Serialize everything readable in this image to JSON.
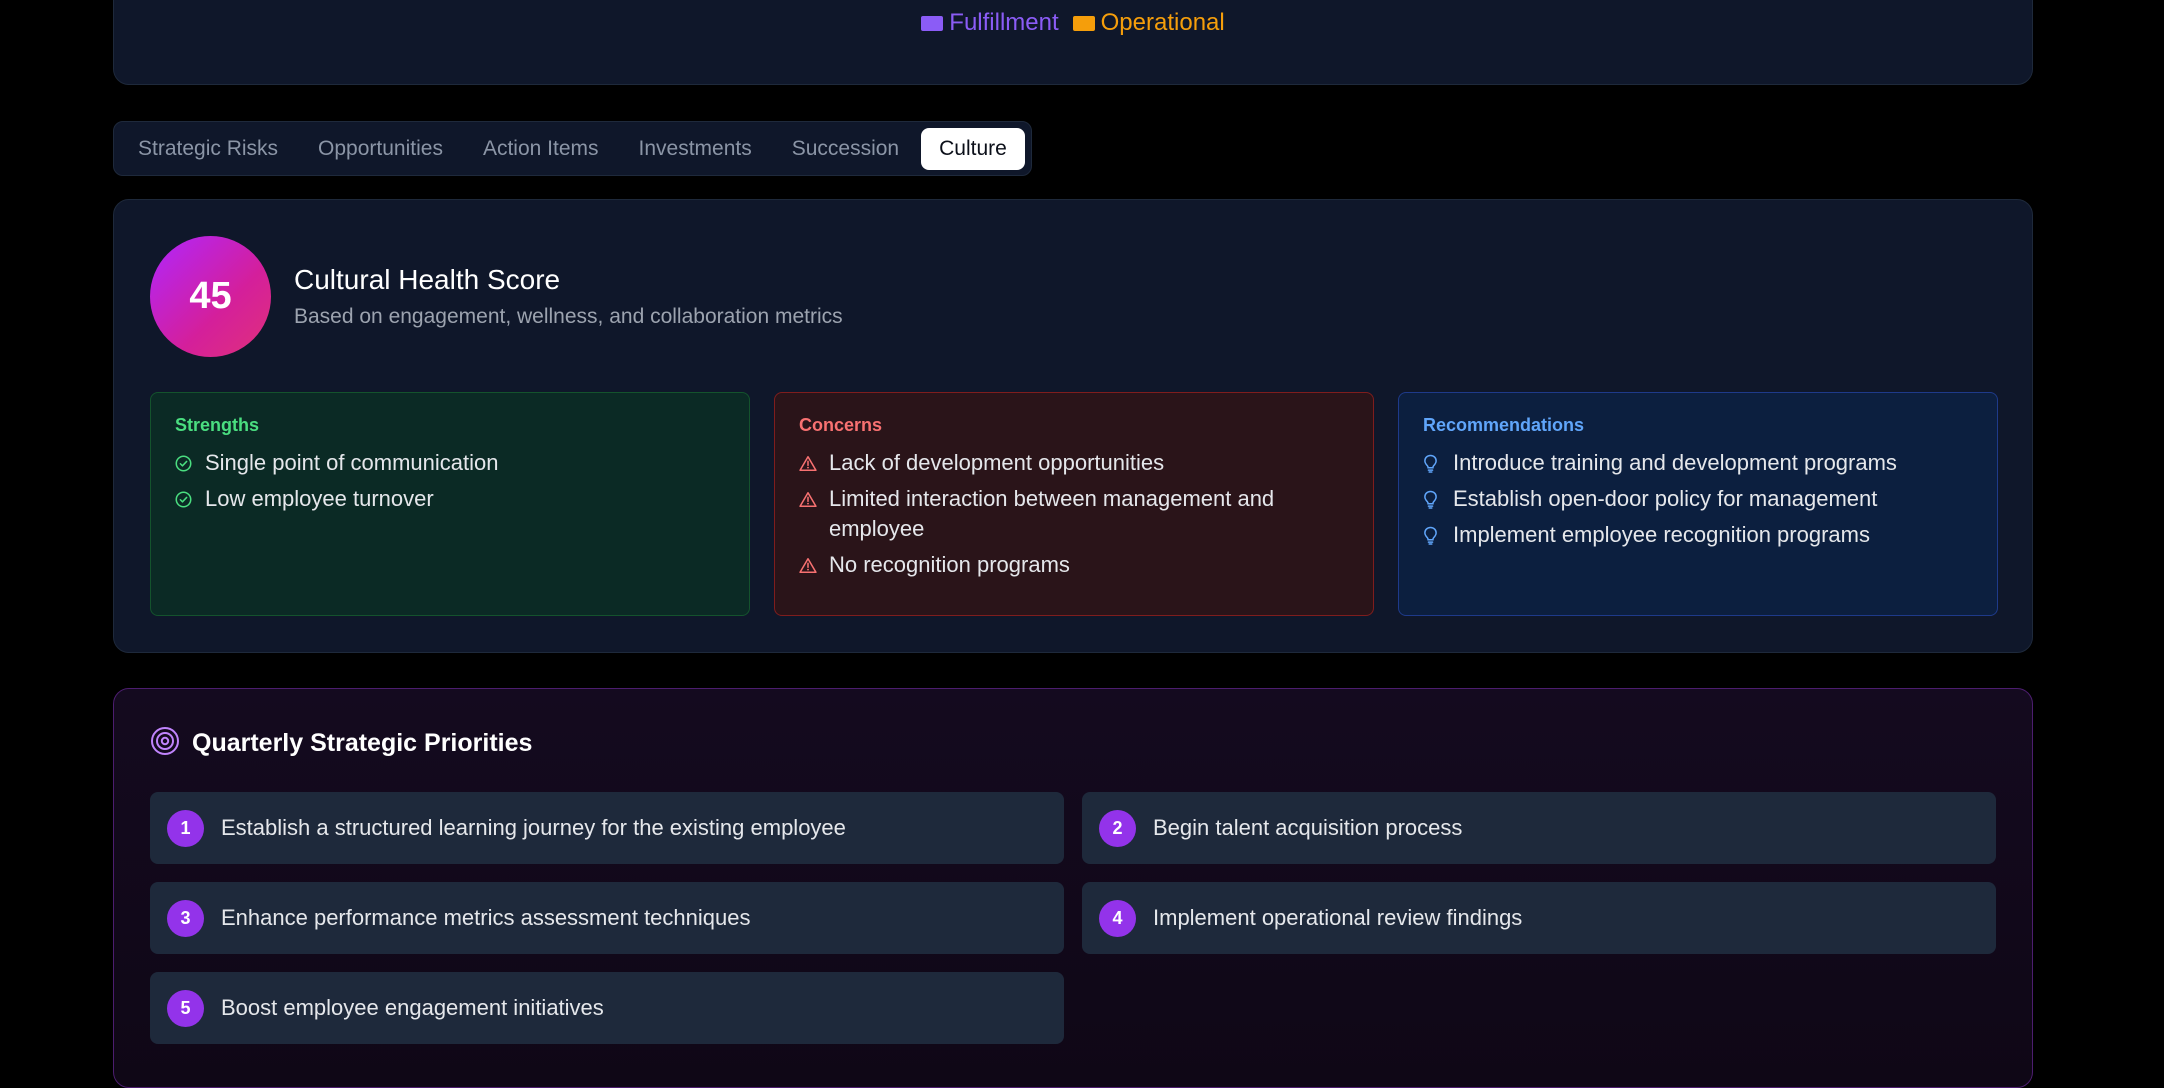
{
  "legend": {
    "items": [
      {
        "label": "Fulfillment",
        "color": "#8b5cf6"
      },
      {
        "label": "Operational",
        "color": "#f59e0b"
      }
    ]
  },
  "tabs": [
    {
      "label": "Strategic Risks",
      "active": false
    },
    {
      "label": "Opportunities",
      "active": false
    },
    {
      "label": "Action Items",
      "active": false
    },
    {
      "label": "Investments",
      "active": false
    },
    {
      "label": "Succession",
      "active": false
    },
    {
      "label": "Culture",
      "active": true
    }
  ],
  "culture": {
    "score": "45",
    "title": "Cultural Health Score",
    "subtitle": "Based on engagement, wellness, and collaboration metrics",
    "strengths": {
      "title": "Strengths",
      "color": "#4ade80",
      "items": [
        "Single point of communication",
        "Low employee turnover"
      ]
    },
    "concerns": {
      "title": "Concerns",
      "color": "#f87171",
      "items": [
        "Lack of development opportunities",
        "Limited interaction between management and employee",
        "No recognition programs"
      ]
    },
    "recommendations": {
      "title": "Recommendations",
      "color": "#60a5fa",
      "items": [
        "Introduce training and development programs",
        "Establish open-door policy for management",
        "Implement employee recognition programs"
      ]
    }
  },
  "priorities": {
    "title": "Quarterly Strategic Priorities",
    "items": [
      {
        "num": "1",
        "text": "Establish a structured learning journey for the existing employee"
      },
      {
        "num": "2",
        "text": "Begin talent acquisition process"
      },
      {
        "num": "3",
        "text": "Enhance performance metrics assessment techniques"
      },
      {
        "num": "4",
        "text": "Implement operational review findings"
      },
      {
        "num": "5",
        "text": "Boost employee engagement initiatives"
      }
    ]
  }
}
